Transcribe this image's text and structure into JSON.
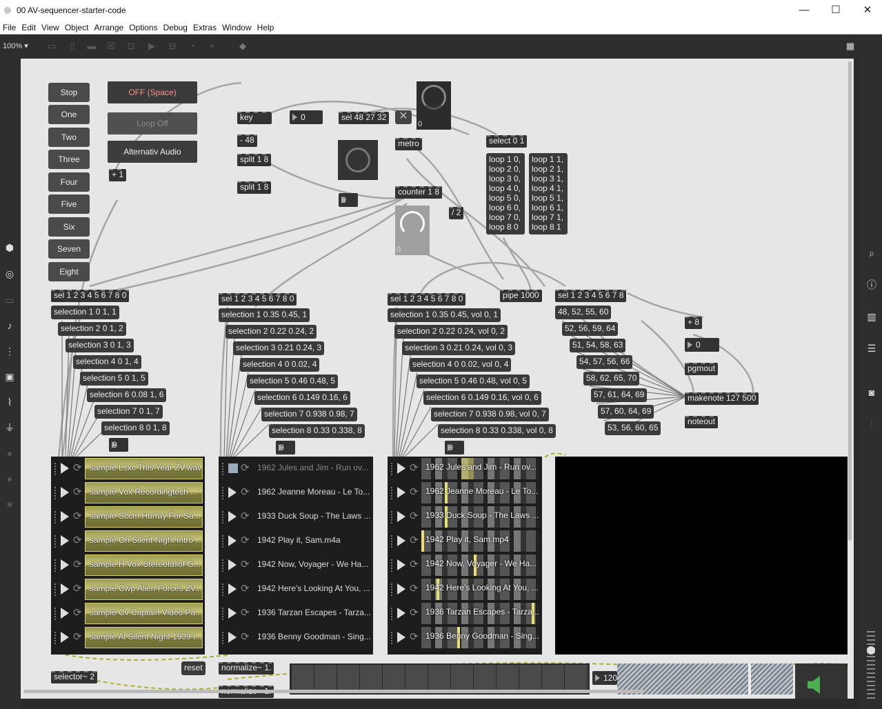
{
  "window": {
    "title": "00 AV-sequencer-starter-code",
    "minimize": "—",
    "maximize": "☐",
    "close": "✕"
  },
  "menu": [
    "File",
    "Edit",
    "View",
    "Object",
    "Arrange",
    "Options",
    "Debug",
    "Extras",
    "Window",
    "Help"
  ],
  "toolbar": {
    "zoom": "100%",
    "zoom_arrow": "▾"
  },
  "buttons": {
    "stop": "Stop",
    "one": "One",
    "two": "Two",
    "three": "Three",
    "four": "Four",
    "five": "Five",
    "six": "Six",
    "seven": "Seven",
    "eight": "Eight"
  },
  "toggles": {
    "off_space": "OFF (Space)",
    "loop_off": "Loop Off",
    "alt_audio": "Alternativ Audio"
  },
  "objects": {
    "plus1": "+ 1",
    "key": "key",
    "minus48": "- 48",
    "split1": "split 1 8",
    "split2": "split 1 8",
    "num0a": "0",
    "sel48": "sel 48 27 32",
    "x": "✕",
    "metro": "metro",
    "num0b": "0",
    "counter": "counter 1 8",
    "div2": "/ 2",
    "select01": "select 0 1",
    "dial1val": "0",
    "dial2val": "0",
    "pipe": "pipe 1000",
    "plus8": "+ 8",
    "num0c": "0",
    "pgmout": "pgmout",
    "makenote": "makenote 127 500",
    "noteout": "noteout",
    "selector": "selector~ 2",
    "reset": "reset",
    "normalize1": "normalize~ 1.",
    "normalize2": "normalize~ 1.",
    "tempo": "120"
  },
  "loop_msgs": {
    "off": [
      "loop 1 0,",
      "loop 2 0,",
      "loop 3 0,",
      "loop 4 0,",
      "loop 5 0,",
      "loop 6 0,",
      "loop 7 0,",
      "loop 8 0"
    ],
    "on": [
      "loop 1 1,",
      "loop 2 1,",
      "loop 3 1,",
      "loop 4 1,",
      "loop 5 1,",
      "loop 6 1,",
      "loop 7 1,",
      "loop 8 1"
    ]
  },
  "col1": {
    "sel": "sel 1 2 3 4 5 6 7 8 0",
    "items": [
      "selection 1 0 1, 1",
      "selection 2 0 1, 2",
      "selection 3 0 1, 3",
      "selection 4 0 1, 4",
      "selection 5 0 1, 5",
      "selection 6 0.08 1, 6",
      "selection 7 0 1, 7",
      "selection 8 0 1, 8"
    ],
    "num": "0"
  },
  "col2": {
    "sel": "sel 1 2 3 4 5 6 7 8 0",
    "items": [
      "selection 1 0.35 0.45, 1",
      "selection 2 0.22 0.24, 2",
      "selection 3 0.21 0.24, 3",
      "selection 4 0 0.02, 4",
      "selection 5 0.46 0.48, 5",
      "selection 6 0.149 0.16, 6",
      "selection 7 0.938 0.98, 7",
      "selection 8 0.33 0.338, 8"
    ],
    "num": "0"
  },
  "col3": {
    "sel": "sel 1 2 3 4 5 6 7 8 0",
    "items": [
      "selection 1 0.35 0.45, vol 0, 1",
      "selection 2 0.22 0.24, vol 0, 2",
      "selection 3 0.21 0.24, vol 0, 3",
      "selection 4 0 0.02, vol 0, 4",
      "selection 5 0.46 0.48, vol 0, 5",
      "selection 6 0.149 0.16, vol 0, 6",
      "selection 7 0.938 0.98, vol 0, 7",
      "selection 8 0.33 0.338, vol 0, 8"
    ],
    "num": "0"
  },
  "col4": {
    "sel": "sel 1 2 3 4 5 6 7 8",
    "items": [
      "48, 52, 55, 60",
      "52, 56, 59, 64",
      "51, 54, 58, 63",
      "54, 57, 56, 66",
      "58, 62, 65, 70",
      "57, 61, 64, 69",
      "57, 60, 64, 69",
      "53, 56, 60, 65"
    ]
  },
  "playlist_audio": [
    "sample Lsxc This Year ZV.wav",
    "sample Vox Recordingtech ...",
    "sample Sccm Hurray For Sa...",
    "sample Oh Silent Night Intro ...",
    "sample H Vox Stereofullof G...",
    "sample Cwp Alien Forces ZV...",
    "sample Cv Captain Video Pa...",
    "sample Al Silent Night 1939 l..."
  ],
  "playlist_mixed": [
    "1962 Jules and Jim - Run ov...",
    "1962 Jeanne Moreau - Le To...",
    "1933 Duck Soup - The Laws ...",
    "1942 Play it, Sam.m4a",
    "1942 Now, Voyager - We Ha...",
    "1942 Here's Looking At You, ...",
    "1936 Tarzan Escapes - Tarza...",
    "1936 Benny Goodman - Sing..."
  ],
  "playlist_video": [
    "1962 Jules and Jim - Run ov...",
    "1962 Jeanne Moreau - Le To...",
    "1933 Duck Soup - The Laws ...",
    "1942 Play it, Sam.mp4",
    "1942 Now, Voyager - We Ha...",
    "1942 Here's Looking At You, ...",
    "1936 Tarzan Escapes - Tarza...",
    "1936 Benny Goodman - Sing..."
  ]
}
